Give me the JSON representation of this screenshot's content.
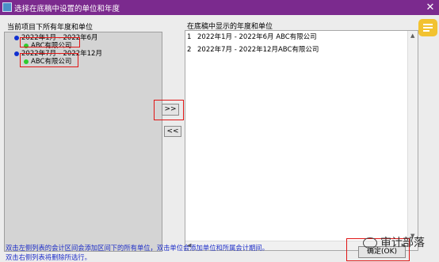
{
  "window": {
    "title": "选择在底稿中设置的单位和年度",
    "close_glyph": "✕"
  },
  "left_panel": {
    "label": "当前项目下所有年度和单位",
    "tree": [
      {
        "period": "2022年1月 - 2022年6月",
        "unit": "ABC有限公司"
      },
      {
        "period": "2022年7月 - 2022年12月",
        "unit": "ABC有限公司"
      }
    ]
  },
  "right_panel": {
    "label": "在底稿中显示的年度和单位",
    "rows": [
      {
        "num": "1",
        "text": "2022年1月 - 2022年6月 ABC有限公司"
      },
      {
        "num": "2",
        "text": "2022年7月 - 2022年12月ABC有限公司"
      }
    ]
  },
  "buttons": {
    "add": ">>",
    "remove": "<<",
    "ok": "确定(OK)"
  },
  "hints": [
    "双击左侧列表的会计区间会添加区间下的所有单位，双击单位会添加单位和所属会计期间。",
    "双击右侧列表将删除所选行。"
  ],
  "watermark": "审计部落",
  "colors": {
    "titlebar": "#7b2a8e",
    "highlight": "#e01515",
    "hint_text": "#1e2ec8",
    "badge": "#f2c230"
  },
  "icons": [
    "window-app-icon",
    "close-icon",
    "scroll-up-arrow-icon",
    "scroll-down-arrow-icon",
    "scroll-left-arrow-icon",
    "scroll-right-arrow-icon",
    "badge-icon",
    "wechat-icon"
  ]
}
